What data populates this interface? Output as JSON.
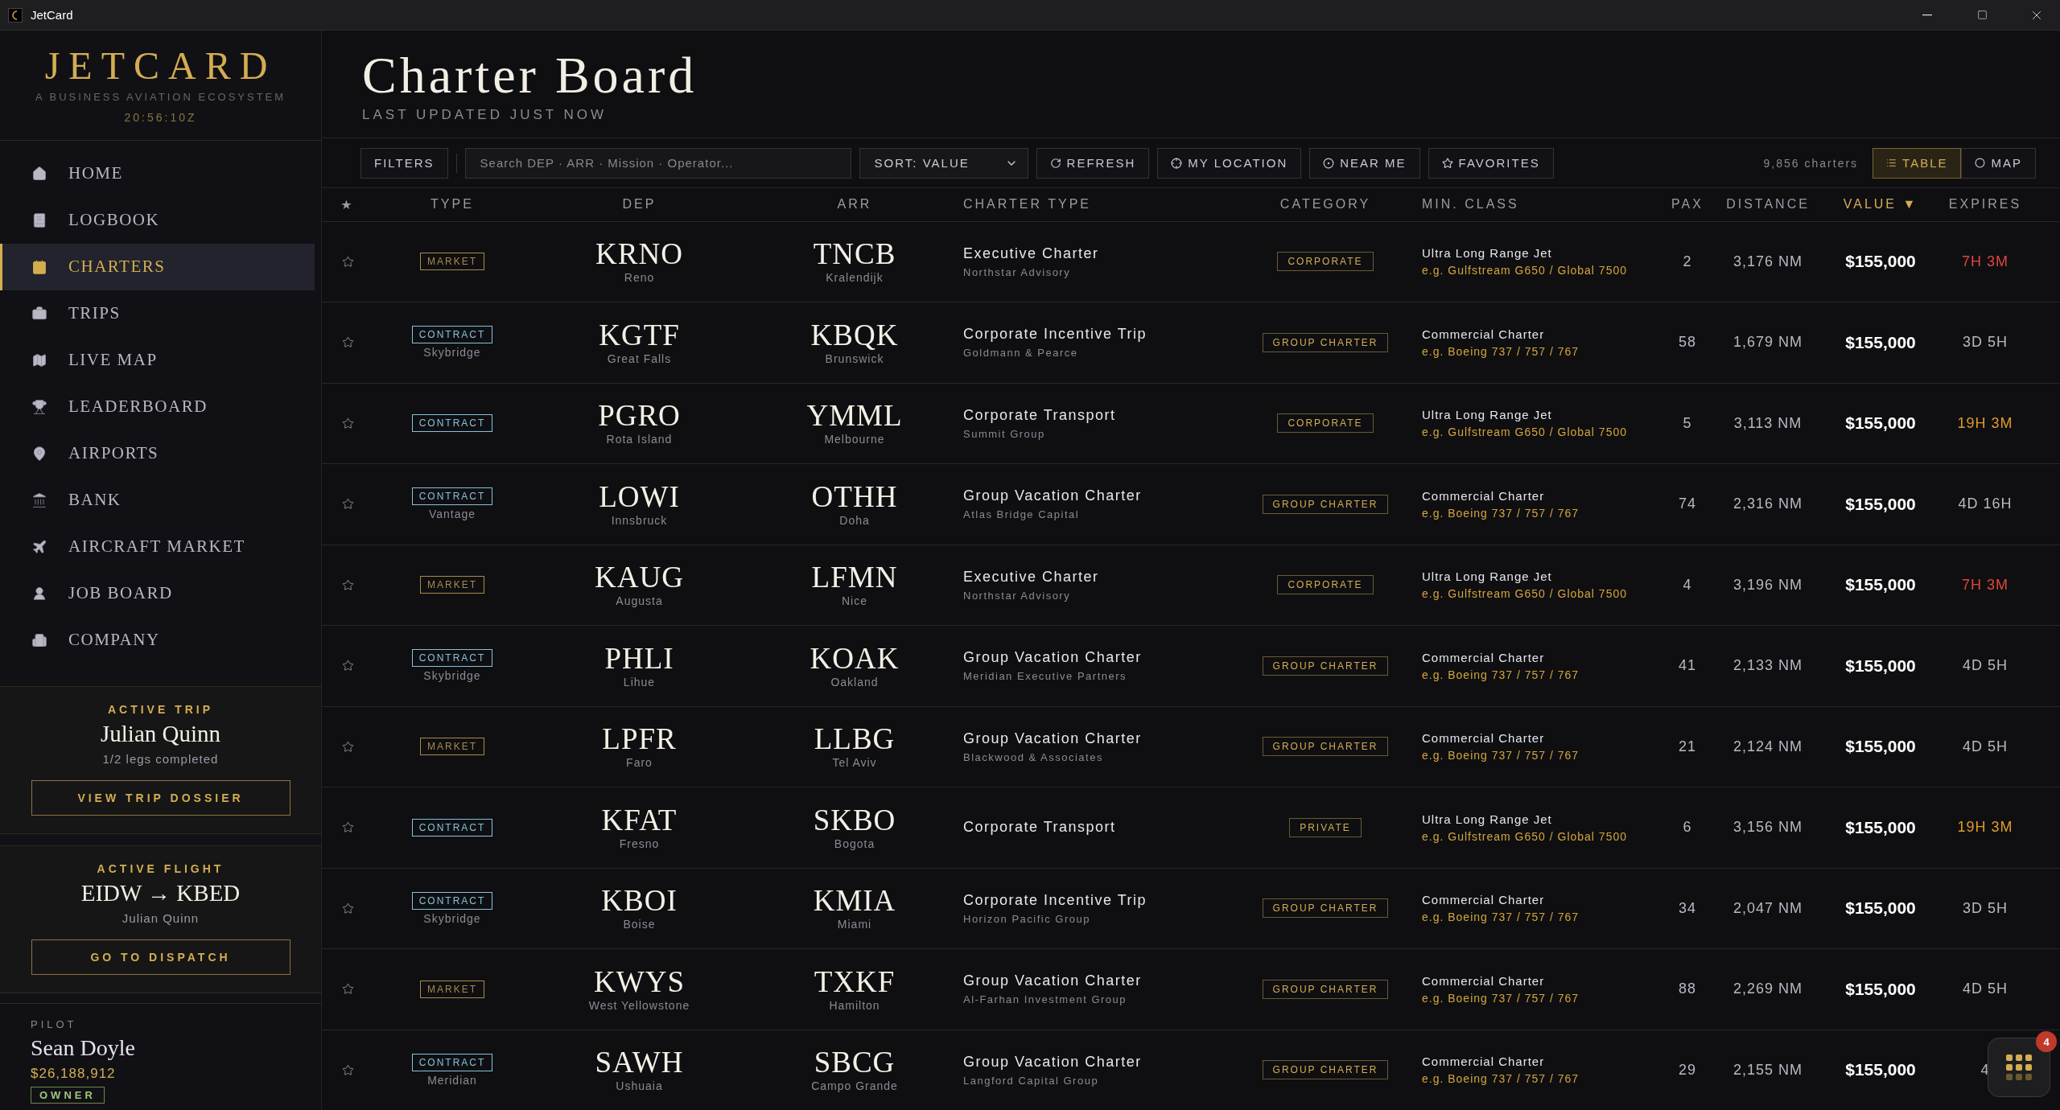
{
  "window": {
    "title": "JetCard"
  },
  "sidebar": {
    "logo": "JETCARD",
    "tagline": "A BUSINESS AVIATION ECOSYSTEM",
    "clock": "20:56:10Z",
    "items": [
      {
        "label": "HOME",
        "selected": false
      },
      {
        "label": "LOGBOOK",
        "selected": false
      },
      {
        "label": "CHARTERS",
        "selected": true
      },
      {
        "label": "TRIPS",
        "selected": false
      },
      {
        "label": "LIVE MAP",
        "selected": false
      },
      {
        "label": "LEADERBOARD",
        "selected": false
      },
      {
        "label": "AIRPORTS",
        "selected": false
      },
      {
        "label": "BANK",
        "selected": false
      },
      {
        "label": "AIRCRAFT MARKET",
        "selected": false
      },
      {
        "label": "JOB BOARD",
        "selected": false
      },
      {
        "label": "COMPANY",
        "selected": false
      }
    ],
    "cards": [
      {
        "heading": "ACTIVE TRIP",
        "title": "Julian Quinn",
        "detail": "1/2 legs completed",
        "button": "VIEW TRIP DOSSIER"
      },
      {
        "heading": "ACTIVE FLIGHT",
        "title": "EIDW → KBED",
        "detail": "Julian Quinn",
        "button": "GO TO DISPATCH"
      }
    ],
    "pilot": {
      "label": "PILOT",
      "name": "Sean Doyle",
      "balance": "$26,188,912",
      "role": "OWNER"
    }
  },
  "header": {
    "title": "Charter Board",
    "subtitle": "LAST UPDATED JUST NOW"
  },
  "toolbar": {
    "filters": "FILTERS",
    "search": {
      "placeholder": "Search DEP · ARR · Mission · Operator..."
    },
    "sort": "SORT: VALUE",
    "buttons": [
      "REFRESH",
      "MY LOCATION",
      "NEAR ME",
      "FAVORITES"
    ],
    "count": "9,856 charters",
    "views": [
      {
        "label": "TABLE",
        "selected": true
      },
      {
        "label": "MAP",
        "selected": false
      }
    ]
  },
  "table": {
    "columns": [
      "★",
      "TYPE",
      "DEP",
      "ARR",
      "CHARTER TYPE",
      "CATEGORY",
      "MIN. CLASS",
      "PAX",
      "DISTANCE",
      "VALUE ▼",
      "EXPIRES"
    ],
    "rows": [
      {
        "favorite": false,
        "type": {
          "kind": "market",
          "label": "MARKET"
        },
        "dep": {
          "code": "KRNO",
          "city": "Reno"
        },
        "arr": {
          "code": "TNCB",
          "city": "Kralendijk"
        },
        "charter": "Executive Charter",
        "operator": "Northstar Advisory",
        "category": "CORPORATE",
        "min_class": "Ultra Long Range Jet",
        "example": "e.g. Gulfstream G650 / Global 7500",
        "pax": "2",
        "distance": "3,176 NM",
        "value": "$155,000",
        "expires": "7H 3M",
        "color": "#e0473a"
      },
      {
        "favorite": false,
        "type": {
          "kind": "contract",
          "label": "CONTRACT",
          "operator": "Skybridge"
        },
        "dep": {
          "code": "KGTF",
          "city": "Great Falls"
        },
        "arr": {
          "code": "KBQK",
          "city": "Brunswick"
        },
        "charter": "Corporate Incentive Trip",
        "operator": "Goldmann & Pearce",
        "category": "GROUP CHARTER",
        "min_class": "Commercial Charter",
        "example": "e.g. Boeing 737 / 757 / 767",
        "pax": "58",
        "distance": "1,679 NM",
        "value": "$155,000",
        "expires": "3D 5H",
        "color": "#b8b8c4"
      },
      {
        "favorite": false,
        "type": {
          "kind": "contract",
          "label": "CONTRACT"
        },
        "dep": {
          "code": "PGRO",
          "city": "Rota Island"
        },
        "arr": {
          "code": "YMML",
          "city": "Melbourne"
        },
        "charter": "Corporate Transport",
        "operator": "Summit Group",
        "category": "CORPORATE",
        "min_class": "Ultra Long Range Jet",
        "example": "e.g. Gulfstream G650 / Global 7500",
        "pax": "5",
        "distance": "3,113 NM",
        "value": "$155,000",
        "expires": "19H 3M",
        "color": "#e09a2a"
      },
      {
        "favorite": false,
        "type": {
          "kind": "contract",
          "label": "CONTRACT",
          "operator": "Vantage"
        },
        "dep": {
          "code": "LOWI",
          "city": "Innsbruck"
        },
        "arr": {
          "code": "OTHH",
          "city": "Doha"
        },
        "charter": "Group Vacation Charter",
        "operator": "Atlas Bridge Capital",
        "category": "GROUP CHARTER",
        "min_class": "Commercial Charter",
        "example": "e.g. Boeing 737 / 757 / 767",
        "pax": "74",
        "distance": "2,316 NM",
        "value": "$155,000",
        "expires": "4D 16H",
        "color": "#b8b8c4"
      },
      {
        "favorite": false,
        "type": {
          "kind": "market",
          "label": "MARKET"
        },
        "dep": {
          "code": "KAUG",
          "city": "Augusta"
        },
        "arr": {
          "code": "LFMN",
          "city": "Nice"
        },
        "charter": "Executive Charter",
        "operator": "Northstar Advisory",
        "category": "CORPORATE",
        "min_class": "Ultra Long Range Jet",
        "example": "e.g. Gulfstream G650 / Global 7500",
        "pax": "4",
        "distance": "3,196 NM",
        "value": "$155,000",
        "expires": "7H 3M",
        "color": "#e0473a"
      },
      {
        "favorite": false,
        "type": {
          "kind": "contract",
          "label": "CONTRACT",
          "operator": "Skybridge"
        },
        "dep": {
          "code": "PHLI",
          "city": "Lihue"
        },
        "arr": {
          "code": "KOAK",
          "city": "Oakland"
        },
        "charter": "Group Vacation Charter",
        "operator": "Meridian Executive Partners",
        "category": "GROUP CHARTER",
        "min_class": "Commercial Charter",
        "example": "e.g. Boeing 737 / 757 / 767",
        "pax": "41",
        "distance": "2,133 NM",
        "value": "$155,000",
        "expires": "4D 5H",
        "color": "#b8b8c4"
      },
      {
        "favorite": false,
        "type": {
          "kind": "market",
          "label": "MARKET"
        },
        "dep": {
          "code": "LPFR",
          "city": "Faro"
        },
        "arr": {
          "code": "LLBG",
          "city": "Tel Aviv"
        },
        "charter": "Group Vacation Charter",
        "operator": "Blackwood & Associates",
        "category": "GROUP CHARTER",
        "min_class": "Commercial Charter",
        "example": "e.g. Boeing 737 / 757 / 767",
        "pax": "21",
        "distance": "2,124 NM",
        "value": "$155,000",
        "expires": "4D 5H",
        "color": "#b8b8c4"
      },
      {
        "favorite": false,
        "type": {
          "kind": "contract",
          "label": "CONTRACT"
        },
        "dep": {
          "code": "KFAT",
          "city": "Fresno"
        },
        "arr": {
          "code": "SKBO",
          "city": "Bogota"
        },
        "charter": "Corporate Transport",
        "category": "PRIVATE",
        "min_class": "Ultra Long Range Jet",
        "example": "e.g. Gulfstream G650 / Global 7500",
        "pax": "6",
        "distance": "3,156 NM",
        "value": "$155,000",
        "expires": "19H 3M",
        "color": "#e09a2a"
      },
      {
        "favorite": false,
        "type": {
          "kind": "contract",
          "label": "CONTRACT",
          "operator": "Skybridge"
        },
        "dep": {
          "code": "KBOI",
          "city": "Boise"
        },
        "arr": {
          "code": "KMIA",
          "city": "Miami"
        },
        "charter": "Corporate Incentive Trip",
        "operator": "Horizon Pacific Group",
        "category": "GROUP CHARTER",
        "min_class": "Commercial Charter",
        "example": "e.g. Boeing 737 / 757 / 767",
        "pax": "34",
        "distance": "2,047 NM",
        "value": "$155,000",
        "expires": "3D 5H",
        "color": "#b8b8c4"
      },
      {
        "favorite": false,
        "type": {
          "kind": "market",
          "label": "MARKET"
        },
        "dep": {
          "code": "KWYS",
          "city": "West Yellowstone"
        },
        "arr": {
          "code": "TXKF",
          "city": "Hamilton"
        },
        "charter": "Group Vacation Charter",
        "operator": "Al-Farhan Investment Group",
        "category": "GROUP CHARTER",
        "min_class": "Commercial Charter",
        "example": "e.g. Boeing 737 / 757 / 767",
        "pax": "88",
        "distance": "2,269 NM",
        "value": "$155,000",
        "expires": "4D 5H",
        "color": "#b8b8c4"
      },
      {
        "favorite": false,
        "type": {
          "kind": "contract",
          "label": "CONTRACT",
          "operator": "Meridian"
        },
        "dep": {
          "code": "SAWH",
          "city": "Ushuaia"
        },
        "arr": {
          "code": "SBCG",
          "city": "Campo Grande"
        },
        "charter": "Group Vacation Charter",
        "operator": "Langford Capital Group",
        "category": "GROUP CHARTER",
        "min_class": "Commercial Charter",
        "example": "e.g. Boeing 737 / 757 / 767",
        "pax": "29",
        "distance": "2,155 NM",
        "value": "$155,000",
        "expires": "4",
        "color": "#b8b8c4"
      }
    ]
  },
  "launcher": {
    "badge": "4"
  }
}
